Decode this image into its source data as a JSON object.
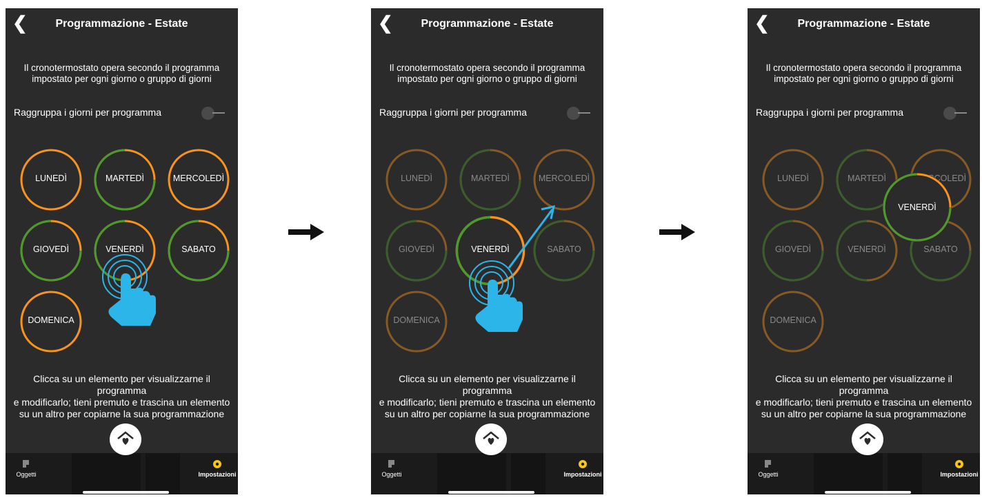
{
  "screen": {
    "title": "Programmazione - Estate",
    "description_line1": "Il cronotermostato opera secondo il programma",
    "description_line2": "impostato per ogni giorno o gruppo di giorni",
    "group_label": "Raggruppa i giorni per programma",
    "footer_line1": "Clicca su un elemento per visualizzarne il programma",
    "footer_line2": "e modificarlo; tieni premuto e trascina un elemento",
    "footer_line3": "su un altro per copiarne la sua programmazione",
    "days": [
      "LUNEDÌ",
      "MARTEDÌ",
      "MERCOLEDÌ",
      "GIOVEDÌ",
      "VENERDÌ",
      "SABATO",
      "DOMENICA"
    ],
    "tabs": {
      "objects": "Oggetti",
      "settings": "Impostazioni"
    },
    "dragged_day": "VENERDÌ"
  },
  "colors": {
    "orange": "#f7931e",
    "green": "#4a9a2e",
    "touch": "#2bb5e8",
    "settings": "#f5c518"
  },
  "icons": [
    "back-icon",
    "toggle-switch",
    "home-heart-icon",
    "objects-icon",
    "gear-icon",
    "hand-pointer-icon",
    "arrow-right-icon"
  ]
}
